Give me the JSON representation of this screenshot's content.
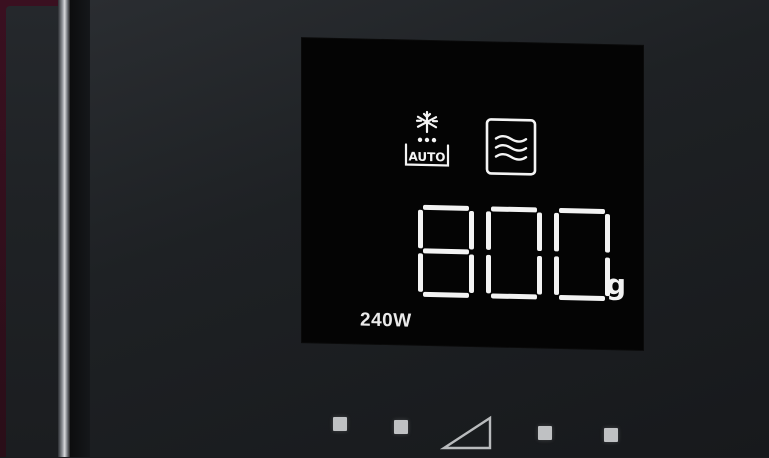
{
  "display": {
    "weight_value": "800",
    "weight_unit": "g",
    "power_level": "240W",
    "defrost_label": "AUTO"
  },
  "icons": {
    "defrost": "auto-defrost-icon",
    "microwave": "microwave-icon",
    "start": "start-triangle-icon"
  },
  "colors": {
    "display_glow": "#ffffff",
    "display_background": "#040404",
    "panel": "#1f2225",
    "frame": "#2a0e18"
  }
}
